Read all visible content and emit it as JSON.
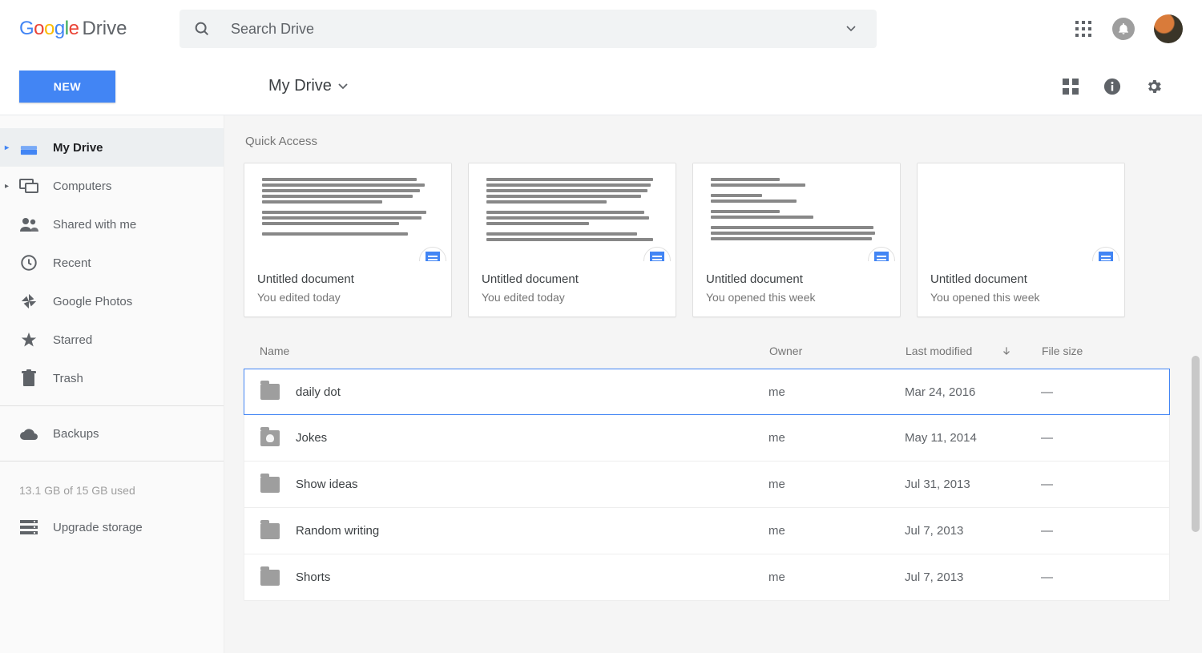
{
  "header": {
    "product": "Drive",
    "search_placeholder": "Search Drive"
  },
  "toolbar": {
    "new_label": "NEW",
    "breadcrumb": "My Drive"
  },
  "sidebar": {
    "items": [
      {
        "label": "My Drive",
        "icon": "drive",
        "active": true,
        "expandable": true
      },
      {
        "label": "Computers",
        "icon": "computers",
        "active": false,
        "expandable": true
      },
      {
        "label": "Shared with me",
        "icon": "people",
        "active": false,
        "expandable": false
      },
      {
        "label": "Recent",
        "icon": "clock",
        "active": false,
        "expandable": false
      },
      {
        "label": "Google Photos",
        "icon": "pinwheel",
        "active": false,
        "expandable": false
      },
      {
        "label": "Starred",
        "icon": "star",
        "active": false,
        "expandable": false
      },
      {
        "label": "Trash",
        "icon": "trash",
        "active": false,
        "expandable": false
      }
    ],
    "backups_label": "Backups",
    "storage_text": "13.1 GB of 15 GB used",
    "upgrade_label": "Upgrade storage"
  },
  "content": {
    "quick_access_label": "Quick Access",
    "quick_access": [
      {
        "title": "Untitled document",
        "subtitle": "You edited today"
      },
      {
        "title": "Untitled document",
        "subtitle": "You edited today"
      },
      {
        "title": "Untitled document",
        "subtitle": "You opened this week"
      },
      {
        "title": "Untitled document",
        "subtitle": "You opened this week"
      }
    ],
    "columns": {
      "name": "Name",
      "owner": "Owner",
      "modified": "Last modified",
      "size": "File size"
    },
    "rows": [
      {
        "name": "daily dot",
        "owner": "me",
        "modified": "Mar 24, 2016",
        "size": "—",
        "icon": "folder",
        "selected": true
      },
      {
        "name": "Jokes",
        "owner": "me",
        "modified": "May 11, 2014",
        "size": "—",
        "icon": "folder-shared",
        "selected": false
      },
      {
        "name": "Show ideas",
        "owner": "me",
        "modified": "Jul 31, 2013",
        "size": "—",
        "icon": "folder",
        "selected": false
      },
      {
        "name": "Random writing",
        "owner": "me",
        "modified": "Jul 7, 2013",
        "size": "—",
        "icon": "folder",
        "selected": false
      },
      {
        "name": "Shorts",
        "owner": "me",
        "modified": "Jul 7, 2013",
        "size": "—",
        "icon": "folder",
        "selected": false
      }
    ]
  }
}
